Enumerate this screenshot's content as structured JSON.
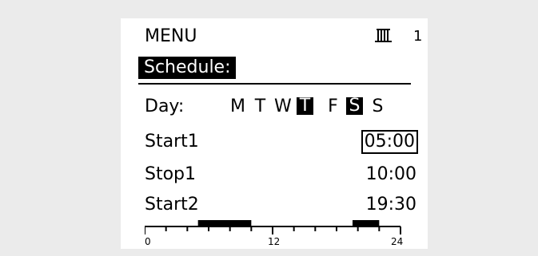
{
  "header": {
    "title": "MENU",
    "circuit_icon": "heating-circuit-icon",
    "circuit_number": "1"
  },
  "section": {
    "title": "Schedule:"
  },
  "day_row": {
    "label": "Day:",
    "days": [
      {
        "letter": "M",
        "selected": false
      },
      {
        "letter": "T",
        "selected": false
      },
      {
        "letter": "W",
        "selected": false
      },
      {
        "letter": "T",
        "selected": true
      },
      {
        "letter": "F",
        "selected": false
      },
      {
        "letter": "S",
        "selected": true
      },
      {
        "letter": "S",
        "selected": false
      }
    ]
  },
  "periods": [
    {
      "label": "Start1",
      "value": "05:00",
      "focused": true
    },
    {
      "label": "Stop1",
      "value": "10:00",
      "focused": false
    },
    {
      "label": "Start2",
      "value": "19:30",
      "focused": false
    }
  ],
  "timeline": {
    "axis_labels": [
      "0",
      "12",
      "24"
    ],
    "range_hours": [
      0,
      24
    ],
    "active_blocks_hours": [
      [
        5,
        10
      ],
      [
        19.5,
        22
      ]
    ]
  }
}
